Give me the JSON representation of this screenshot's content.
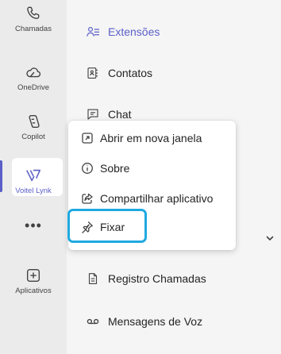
{
  "rail": {
    "items": [
      {
        "label": "Chamadas",
        "icon": "phone-icon"
      },
      {
        "label": "OneDrive",
        "icon": "cloud-icon"
      },
      {
        "label": "Copilot",
        "icon": "copilot-icon"
      },
      {
        "label": "Voitel Lynk",
        "icon": "voitel-lynk-icon"
      },
      {
        "label": "Aplicativos",
        "icon": "add-square-icon"
      }
    ],
    "more": "•••"
  },
  "main": {
    "items": [
      {
        "label": "Extensões",
        "icon": "extensions-icon"
      },
      {
        "label": "Contatos",
        "icon": "contacts-icon"
      },
      {
        "label": "Chat",
        "icon": "chat-icon"
      },
      {
        "label": "Registro Chamadas",
        "icon": "call-log-icon"
      },
      {
        "label": "Mensagens de Voz",
        "icon": "voicemail-icon"
      }
    ]
  },
  "context_menu": {
    "items": [
      {
        "label": "Abrir em nova janela",
        "icon": "open-window-icon"
      },
      {
        "label": "Sobre",
        "icon": "info-icon"
      },
      {
        "label": "Compartilhar aplicativo",
        "icon": "share-icon"
      },
      {
        "label": "Fixar",
        "icon": "pin-icon"
      }
    ]
  },
  "colors": {
    "accent": "#5b5fc7",
    "highlight": "#1fa9e1"
  }
}
